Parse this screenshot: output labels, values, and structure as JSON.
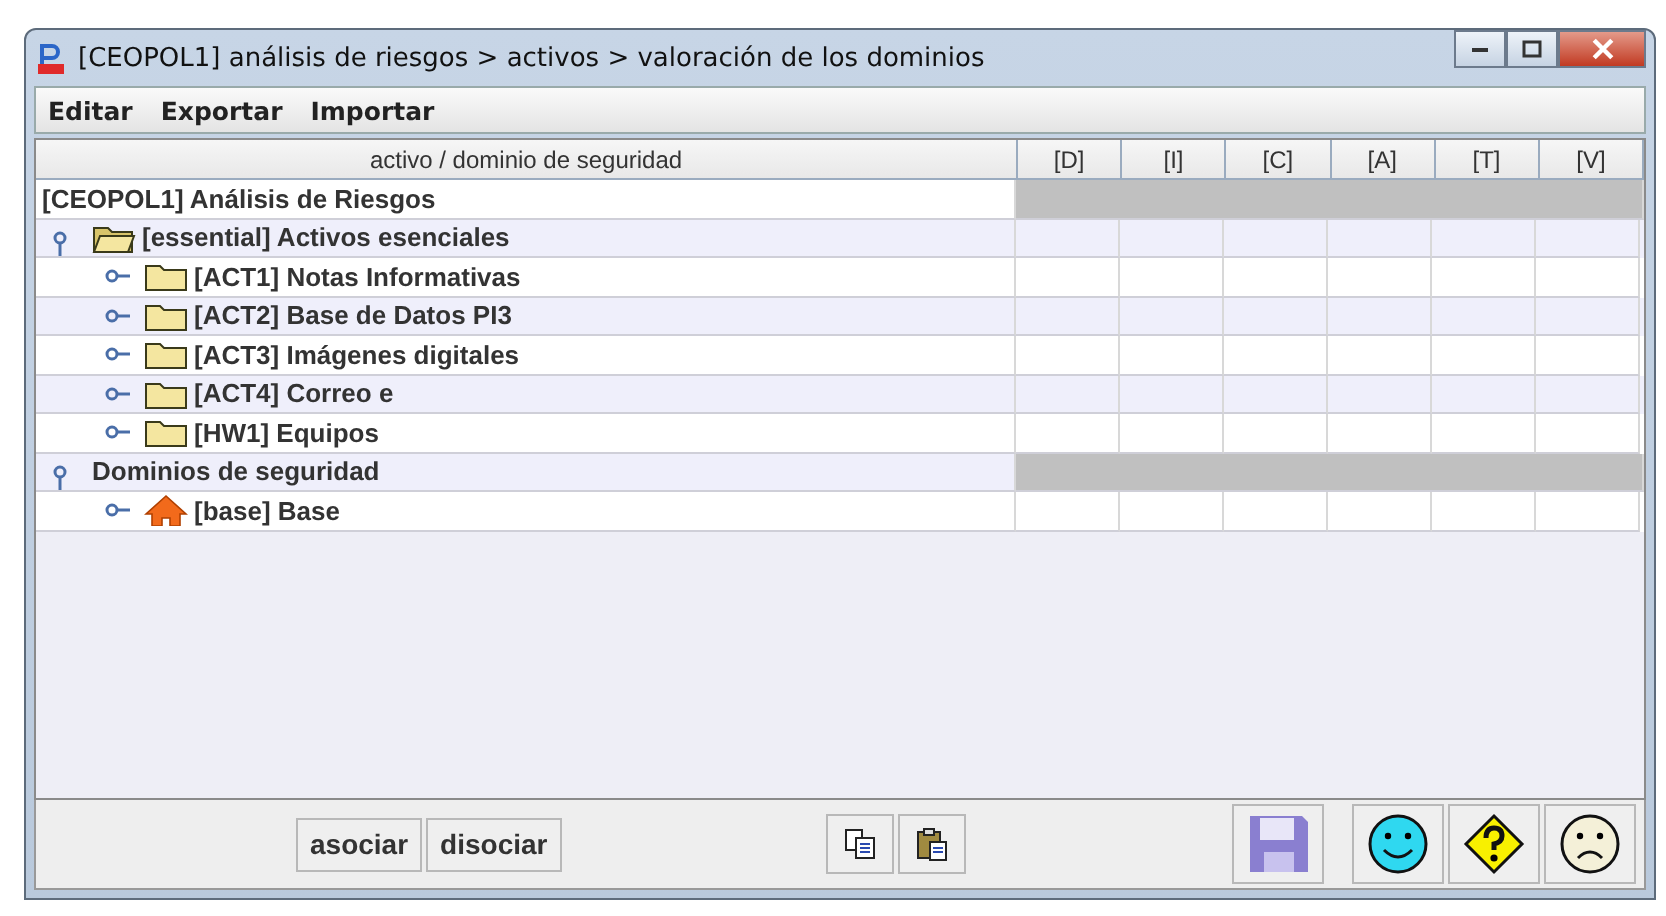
{
  "window": {
    "title": "[CEOPOL1] análisis de riesgos > activos > valoración de los dominios"
  },
  "menu": [
    "Editar",
    "Exportar",
    "Importar"
  ],
  "table": {
    "tree_column": "activo / dominio de seguridad",
    "columns": [
      "[D]",
      "[I]",
      "[C]",
      "[A]",
      "[T]",
      "[V]"
    ]
  },
  "tree": [
    {
      "label": "[CEOPOL1] Análisis de Riesgos",
      "has_values": false,
      "children": [
        {
          "label": "[essential] Activos esenciales",
          "kind": "folder-open",
          "expanded": true,
          "has_values": true,
          "children": [
            {
              "label": "[ACT1] Notas Informativas",
              "kind": "folder",
              "has_values": true
            },
            {
              "label": "[ACT2] Base de Datos PI3",
              "kind": "folder",
              "has_values": true
            },
            {
              "label": "[ACT3] Imágenes digitales",
              "kind": "folder",
              "has_values": true
            },
            {
              "label": "[ACT4] Correo e",
              "kind": "folder",
              "has_values": true
            },
            {
              "label": "[HW1] Equipos",
              "kind": "folder",
              "has_values": true
            }
          ]
        },
        {
          "label": "Dominios de seguridad",
          "expanded": true,
          "has_values": false,
          "children": [
            {
              "label": "[base] Base",
              "kind": "house",
              "has_values": true
            }
          ]
        }
      ]
    }
  ],
  "buttons": [
    "asociar",
    "disociar"
  ]
}
